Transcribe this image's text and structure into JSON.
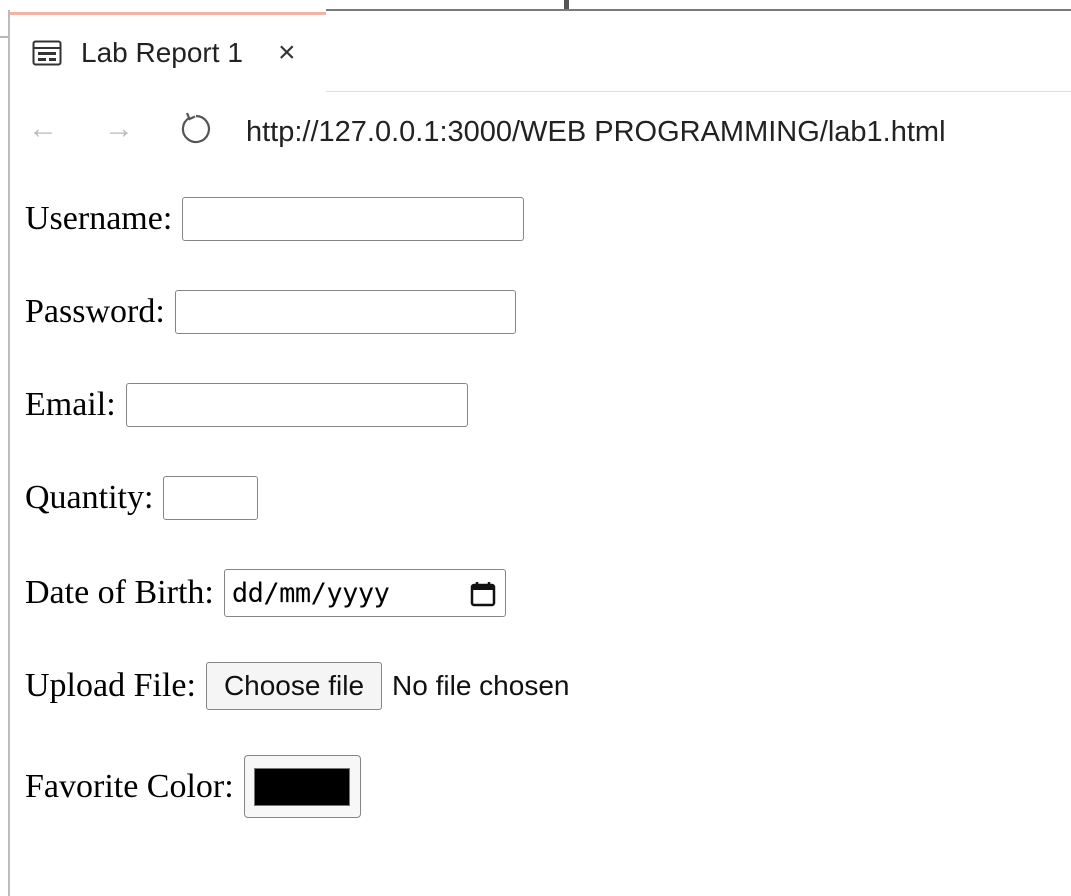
{
  "tab": {
    "title": "Lab Report 1",
    "close_glyph": "×",
    "icon": "page-icon"
  },
  "navigation": {
    "back_glyph": "←",
    "forward_glyph": "→",
    "reload_icon": "reload-icon",
    "url": "http://127.0.0.1:3000/WEB PROGRAMMING/lab1.html"
  },
  "form": {
    "username_label": "Username:",
    "password_label": "Password:",
    "email_label": "Email:",
    "quantity_label": "Quantity:",
    "dob_label": "Date of Birth:",
    "dob_placeholder": "dd/mm/yyyy",
    "upload_label": "Upload File:",
    "choose_file_label": "Choose file",
    "file_status": "No file chosen",
    "favorite_color_label": "Favorite Color:",
    "favorite_color_value": "#000000"
  }
}
